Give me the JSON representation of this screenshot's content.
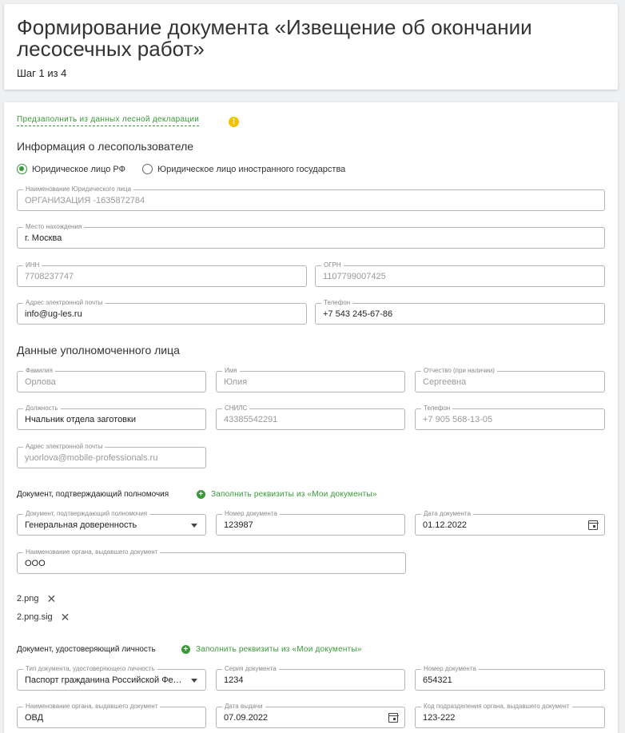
{
  "header": {
    "title": "Формирование документа «Извещение об окончании лесосечных работ»",
    "step": "Шаг 1 из 4"
  },
  "prefill": {
    "link": "Предзаполнить из данных лесной декларации",
    "warn_icon": "!"
  },
  "user_info": {
    "title": "Информация о лесопользователе",
    "radio_ru": "Юридическое лицо РФ",
    "radio_foreign": "Юридическое лицо иностранного государства",
    "org_name": {
      "label": "Наименование Юридического лица",
      "value": "ОРГАНИЗАЦИЯ -1635872784"
    },
    "location": {
      "label": "Место нахождения",
      "value": "г. Москва"
    },
    "inn": {
      "label": "ИНН",
      "value": "7708237747"
    },
    "ogrn": {
      "label": "ОГРН",
      "value": "1107799007425"
    },
    "email": {
      "label": "Адрес электронной почты",
      "value": "info@ug-les.ru"
    },
    "phone": {
      "label": "Телефон",
      "value": "+7 543 245-67-86"
    }
  },
  "authorized": {
    "title": "Данные уполномоченного лица",
    "last_name": {
      "label": "Фамилия",
      "value": "Орлова"
    },
    "first_name": {
      "label": "Имя",
      "value": "Юлия"
    },
    "patronymic": {
      "label": "Отчество (при наличии)",
      "value": "Сергеевна"
    },
    "position": {
      "label": "Должность",
      "value": "Нчальник отдела заготовки"
    },
    "snils": {
      "label": "СНИЛС",
      "value": "43385542291"
    },
    "phone": {
      "label": "Телефон",
      "value": "+7 905 568-13-05"
    },
    "email": {
      "label": "Адрес электронной почты",
      "value": "yuorlova@mobile-professionals.ru"
    }
  },
  "authority_doc": {
    "title": "Документ, подтверждающий полномочия",
    "add_link": "Заполнить реквизиты из «Мои документы»",
    "doc_type": {
      "label": "Документ, подтверждающий полномочия",
      "value": "Генеральная доверенность"
    },
    "doc_number": {
      "label": "Номер документа",
      "value": "123987"
    },
    "doc_date": {
      "label": "Дата документа",
      "value": "01.12.2022"
    },
    "issuer": {
      "label": "Наименование органа, выдавшего документ",
      "value": "ООО"
    },
    "files": [
      "2.png",
      "2.png.sig"
    ]
  },
  "identity_doc": {
    "title": "Документ, удостоверяющий личность",
    "add_link": "Заполнить реквизиты из «Мои документы»",
    "doc_type": {
      "label": "Тип документа, удостоверяющего личность",
      "value": "Паспорт гражданина Российской Федерации"
    },
    "series": {
      "label": "Серия документа",
      "value": "1234"
    },
    "number": {
      "label": "Номер документа",
      "value": "654321"
    },
    "issuer": {
      "label": "Наименование органа, выдавшего документ",
      "value": "ОВД"
    },
    "issue_date": {
      "label": "Дата выдачи",
      "value": "07.09.2022"
    },
    "dept_code": {
      "label": "Код подразделения органа, выдавшего документ",
      "value": "123-222"
    }
  }
}
